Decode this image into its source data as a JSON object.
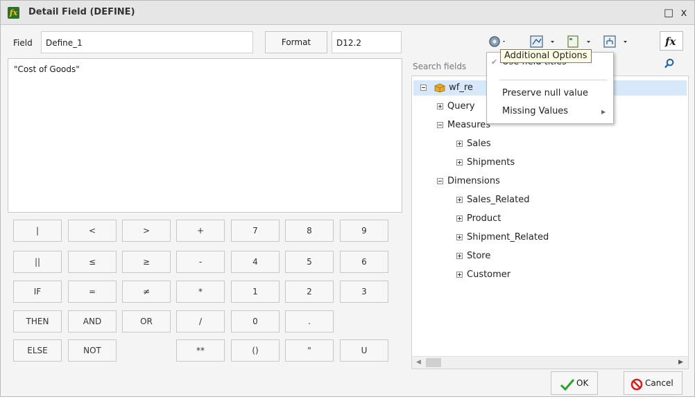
{
  "window": {
    "title": "Detail Field (DEFINE)",
    "icon_name": "define-fx-icon",
    "controls": {
      "maximize": "□",
      "close": "x"
    }
  },
  "left": {
    "field_label": "Field",
    "field_value": "Define_1",
    "format_label": "Format",
    "format_value": "D12.2",
    "expression": "\"Cost of Goods\""
  },
  "keypad": {
    "rows": [
      [
        "|",
        "<",
        ">",
        "+",
        "7",
        "8",
        "9"
      ],
      [
        "||",
        "≤",
        "≥",
        "-",
        "4",
        "5",
        "6"
      ],
      [
        "IF",
        "=",
        "≠",
        "*",
        "1",
        "2",
        "3"
      ],
      [
        "THEN",
        "AND",
        "OR",
        "/",
        "0",
        "."
      ],
      [
        "ELSE",
        "NOT",
        "",
        "**",
        "()",
        "\"",
        "U"
      ]
    ]
  },
  "right": {
    "search_label": "Search fields",
    "toolbar_icons": [
      "gear-icon",
      "field-list-icon",
      "panel-icon",
      "hierarchy-icon",
      "fx-icon"
    ],
    "tree": {
      "root": "wf_re",
      "nodes": [
        {
          "label": "Query",
          "state": "collapsed",
          "level": 1
        },
        {
          "label": "Measures",
          "state": "expanded",
          "level": 1
        },
        {
          "label": "Sales",
          "state": "collapsed",
          "level": 2
        },
        {
          "label": "Shipments",
          "state": "collapsed",
          "level": 2
        },
        {
          "label": "Dimensions",
          "state": "expanded",
          "level": 1
        },
        {
          "label": "Sales_Related",
          "state": "collapsed",
          "level": 2
        },
        {
          "label": "Product",
          "state": "collapsed",
          "level": 2
        },
        {
          "label": "Shipment_Related",
          "state": "collapsed",
          "level": 2
        },
        {
          "label": "Store",
          "state": "collapsed",
          "level": 2
        },
        {
          "label": "Customer",
          "state": "collapsed",
          "level": 2
        }
      ]
    }
  },
  "menu": {
    "tooltip": "Additional Options",
    "items": [
      "Use field titles",
      "Preserve null value",
      "Missing Values"
    ]
  },
  "buttons": {
    "ok": "OK",
    "cancel": "Cancel"
  },
  "colors": {
    "accent_green": "#29a329",
    "cancel_red": "#d42020",
    "tree_selected": "#d6e8fa"
  }
}
